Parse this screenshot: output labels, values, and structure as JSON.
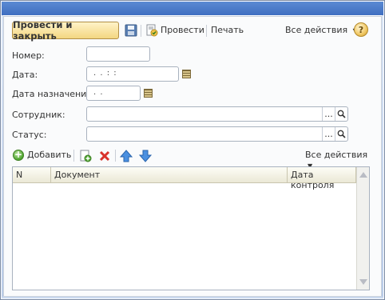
{
  "toolbar": {
    "post_and_close": "Провести и закрыть",
    "post": "Провести",
    "print": "Печать",
    "all_actions": "Все действия",
    "help": "?"
  },
  "form": {
    "number_label": "Номер:",
    "number_value": "",
    "date_label": "Дата:",
    "date_value": ". .     : :",
    "assign_date_label": "Дата назначения:",
    "assign_date_value": ". .",
    "employee_label": "Сотрудник:",
    "employee_value": "",
    "status_label": "Статус:",
    "status_value": "",
    "select_glyph": "..."
  },
  "table_toolbar": {
    "add": "Добавить",
    "all_actions": "Все действия"
  },
  "table": {
    "columns": [
      "N",
      "Документ",
      "Дата контроля"
    ],
    "rows": []
  },
  "colors": {
    "primary_button": "#f3d681",
    "title_bar": "#4a7bc9",
    "delete": "#d9332b",
    "move_arrows": "#3d82d8"
  }
}
